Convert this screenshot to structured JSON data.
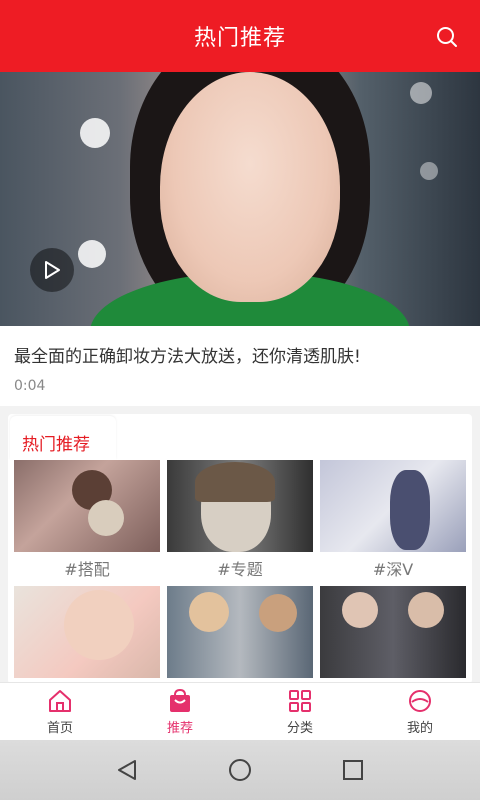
{
  "header": {
    "title": "热门推荐"
  },
  "video": {
    "title": "最全面的正确卸妆方法大放送，还你清透肌肤!",
    "duration": "0:04"
  },
  "recommend": {
    "tab_label": "热门推荐",
    "items": [
      {
        "tag": "#搭配"
      },
      {
        "tag": "#专题"
      },
      {
        "tag": "#深V"
      },
      {
        "tag": ""
      },
      {
        "tag": ""
      },
      {
        "tag": ""
      }
    ]
  },
  "nav": {
    "items": [
      {
        "label": "首页",
        "icon": "home-icon"
      },
      {
        "label": "推荐",
        "icon": "shopping-bag-icon",
        "active": true
      },
      {
        "label": "分类",
        "icon": "grid-icon"
      },
      {
        "label": "我的",
        "icon": "profile-icon"
      }
    ]
  },
  "colors": {
    "brand_red": "#ee1c24",
    "active_pink": "#e5306c"
  }
}
